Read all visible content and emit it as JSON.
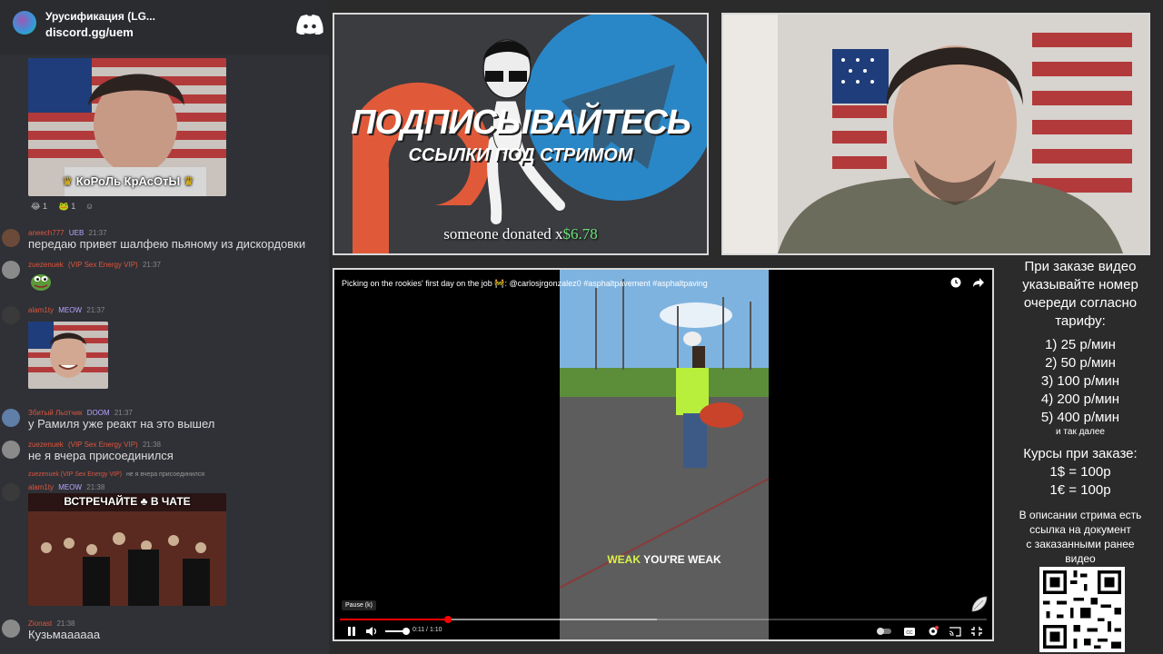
{
  "chat": {
    "server_name": "Урусификация (LG...",
    "server_invite": "discord.gg/uem",
    "messages": [
      {
        "author": "",
        "badge": "",
        "time": "",
        "text": "",
        "image_caption": "КоРоЛь КрАсОтЫ",
        "reactions": [
          "1",
          "1"
        ]
      },
      {
        "author": "aneech777",
        "badge": "UEB",
        "time": "21:37",
        "text": "передаю привет шалфею пьяному из дискордовки"
      },
      {
        "author": "zuezenuek",
        "badge": "(VIP Sex Energy VIP)",
        "time": "21:37",
        "text": ""
      },
      {
        "author": "alam1ty",
        "badge": "MEOW",
        "time": "21:37",
        "text": ""
      },
      {
        "author": "Збитый Льотчик",
        "badge": "DOOM",
        "time": "21:37",
        "text": "у Рамиля уже реакт на это вышел"
      },
      {
        "author": "zuezenuek",
        "badge": "(VIP Sex Energy VIP)",
        "time": "21:38",
        "text": "не я вчера присоединился"
      },
      {
        "author": "alam1ty",
        "badge": "MEOW",
        "time": "21:38",
        "reply_author": "zuezenuek (VIP Sex Energy VIP)",
        "reply_text": "не я вчера присоединился",
        "image_caption": "ВСТРЕЧАЙТЕ ♣ В ЧАТЕ"
      },
      {
        "author": "Zionast",
        "badge": "",
        "time": "21:38",
        "text": "Кузьмаааааа"
      }
    ]
  },
  "promo": {
    "headline": "ПОДПИСЫВАЙТЕСЬ",
    "subline": "ССЫЛКИ ПОД СТРИМОМ",
    "donation_text": "someone donated x",
    "donation_amount": "$6.78"
  },
  "player": {
    "title": "Picking on the rookies' first day on the job 🚧: @carlosjrgonzalez0 #asphaltpavement #asphaltpaving",
    "caption_highlight": "WEAK",
    "caption_rest": "YOU'RE WEAK",
    "tooltip": "Pause (k)",
    "time_readout": "0:11 / 1:10",
    "progress": 0.167,
    "buffered": 0.49,
    "volume": 0.9,
    "colors": {
      "progress": "#ff0000",
      "caption_highlight": "#d7f34c"
    }
  },
  "info": {
    "order_lines": [
      "При заказе видео",
      "указывайте номер",
      "очереди согласно",
      "тарифу:"
    ],
    "tariffs": [
      "1) 25 р/мин",
      "2) 50 р/мин",
      "3) 100 р/мин",
      "4) 200 р/мин",
      "5) 400 р/мин"
    ],
    "tariffs_more": "и так далее",
    "rates_title": "Курсы при заказе:",
    "rates": [
      "1$ = 100р",
      "1€ = 100р"
    ],
    "desc_lines": [
      "В описании стрима есть",
      "ссылка на документ",
      "с заказанными ранее",
      "видео"
    ]
  }
}
